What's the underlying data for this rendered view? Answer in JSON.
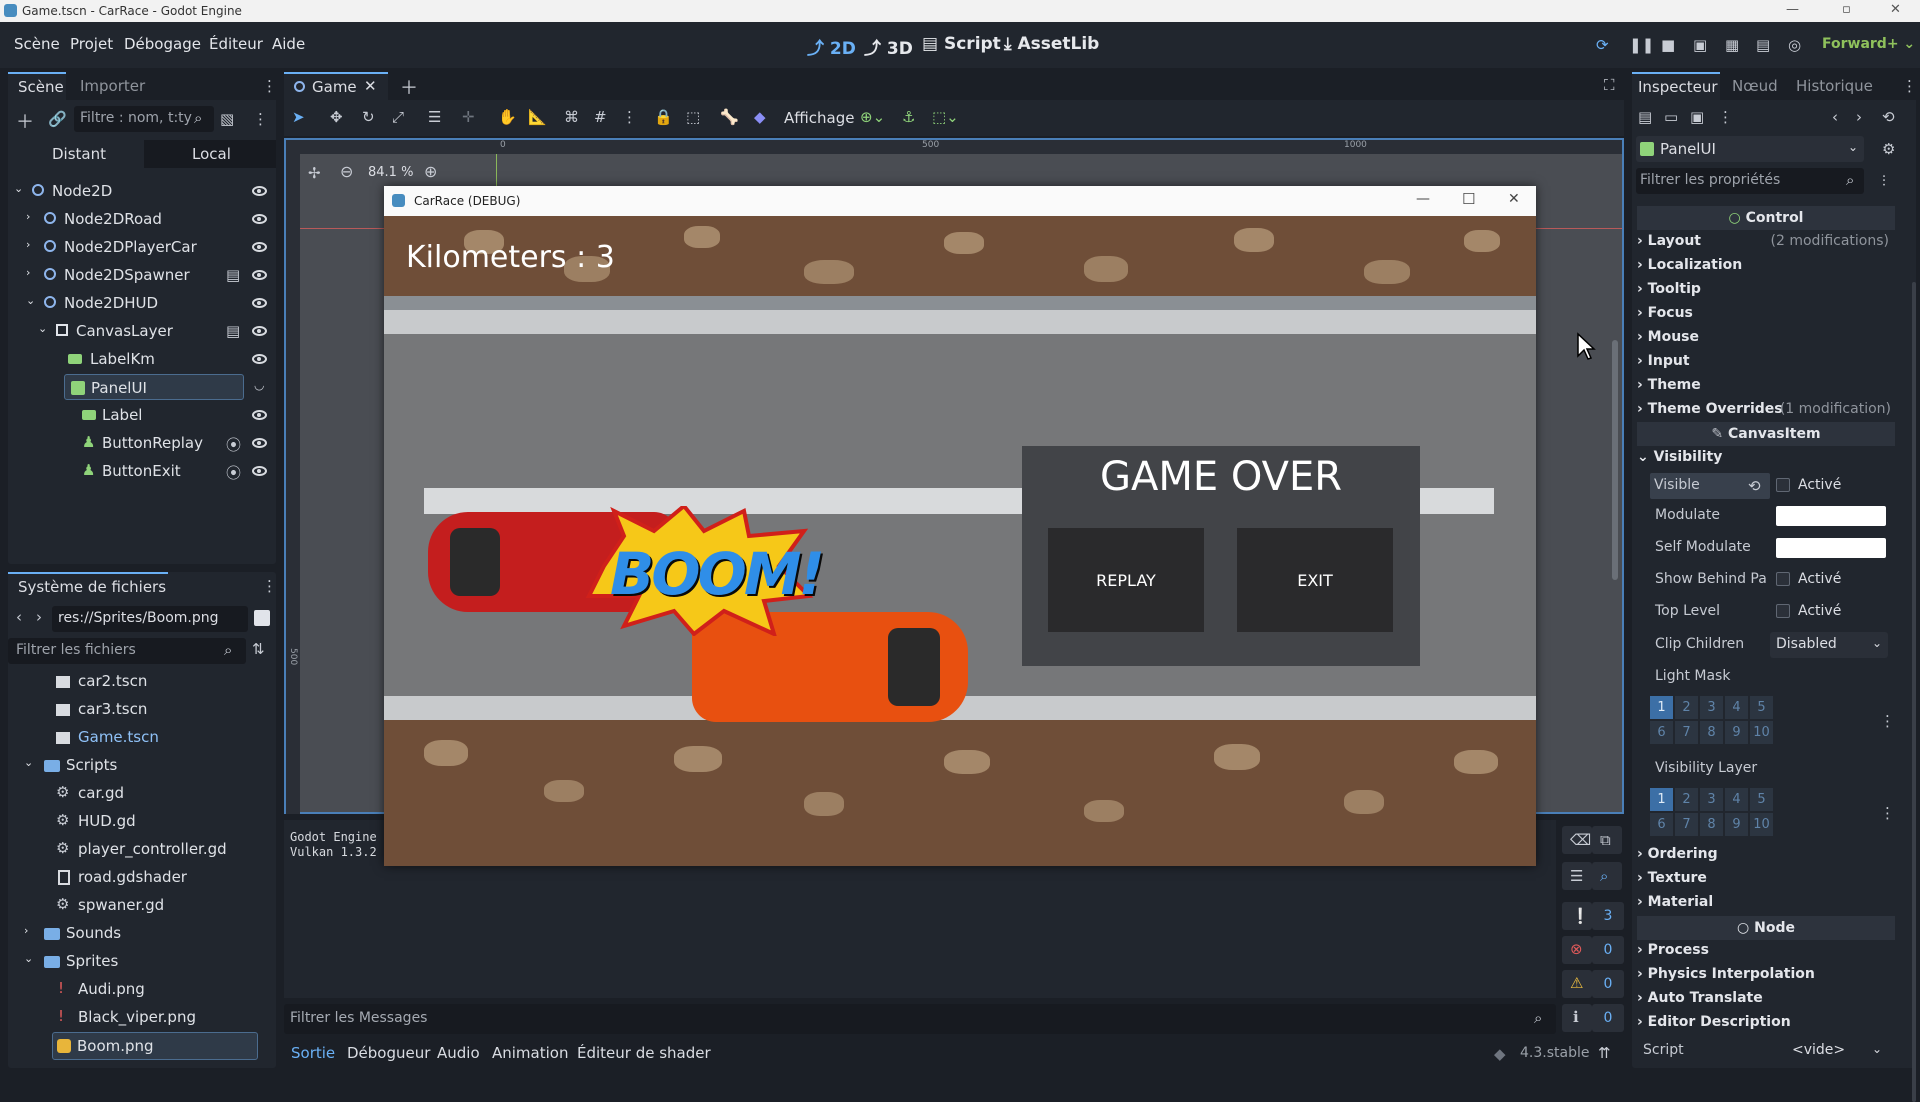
{
  "window": {
    "title": "Game.tscn - CarRace - Godot Engine"
  },
  "menu": [
    "Scène",
    "Projet",
    "Débogage",
    "Éditeur",
    "Aide"
  ],
  "modes": [
    {
      "label": "2D",
      "active": true
    },
    {
      "label": "3D"
    },
    {
      "label": "Script"
    },
    {
      "label": "AssetLib"
    }
  ],
  "renderer": "Forward+",
  "scene_panel": {
    "tabs": [
      "Scène",
      "Importer"
    ],
    "filter_placeholder": "Filtre : nom, t:ty",
    "remote_label": "Distant",
    "local_label": "Local",
    "nodes": [
      {
        "name": "Node2D",
        "depth": 0
      },
      {
        "name": "Node2DRoad",
        "depth": 1
      },
      {
        "name": "Node2DPlayerCar",
        "depth": 1
      },
      {
        "name": "Node2DSpawner",
        "depth": 1
      },
      {
        "name": "Node2DHUD",
        "depth": 1
      },
      {
        "name": "CanvasLayer",
        "depth": 2
      },
      {
        "name": "LabelKm",
        "depth": 3
      },
      {
        "name": "PanelUI",
        "depth": 3,
        "selected": true
      },
      {
        "name": "Label",
        "depth": 4
      },
      {
        "name": "ButtonReplay",
        "depth": 4
      },
      {
        "name": "ButtonExit",
        "depth": 4
      }
    ]
  },
  "filesystem": {
    "title": "Système de fichiers",
    "path": "res://Sprites/Boom.png",
    "filter_placeholder": "Filtrer les fichiers",
    "items": [
      {
        "name": "car2.tscn",
        "depth": 1,
        "type": "scene"
      },
      {
        "name": "car3.tscn",
        "depth": 1,
        "type": "scene"
      },
      {
        "name": "Game.tscn",
        "depth": 1,
        "type": "scene",
        "highlight": true
      },
      {
        "name": "Scripts",
        "depth": 0,
        "type": "folder"
      },
      {
        "name": "car.gd",
        "depth": 1,
        "type": "script"
      },
      {
        "name": "HUD.gd",
        "depth": 1,
        "type": "script"
      },
      {
        "name": "player_controller.gd",
        "depth": 1,
        "type": "script"
      },
      {
        "name": "road.gdshader",
        "depth": 1,
        "type": "shader"
      },
      {
        "name": "spwaner.gd",
        "depth": 1,
        "type": "script"
      },
      {
        "name": "Sounds",
        "depth": 0,
        "type": "folder"
      },
      {
        "name": "Sprites",
        "depth": 0,
        "type": "folder"
      },
      {
        "name": "Audi.png",
        "depth": 1,
        "type": "image"
      },
      {
        "name": "Black_viper.png",
        "depth": 1,
        "type": "image"
      },
      {
        "name": "Boom.png",
        "depth": 1,
        "type": "image",
        "selected": true
      }
    ]
  },
  "editor": {
    "tab": "Game",
    "view_menu": "Affichage",
    "zoom": "84.1 %",
    "ruler_marks": [
      "0",
      "500",
      "1000"
    ],
    "ruler_left_mark": "500"
  },
  "game_window": {
    "title": "CarRace (DEBUG)",
    "km_label": "Kilometers : 3",
    "game_over": "GAME OVER",
    "replay": "REPLAY",
    "exit": "EXIT",
    "boom": "BOOM!"
  },
  "output": {
    "lines": [
      "Godot Engine",
      "Vulkan 1.3.2"
    ],
    "filter_placeholder": "Filtrer les Messages",
    "tabs": [
      "Sortie",
      "Débogueur",
      "Audio",
      "Animation",
      "Éditeur de shader"
    ],
    "version": "4.3.stable",
    "counts": {
      "messages": "3",
      "errors": "0",
      "warnings": "0",
      "info": "0"
    }
  },
  "inspector": {
    "tabs": [
      "Inspecteur",
      "Nœud",
      "Historique"
    ],
    "node_name": "PanelUI",
    "filter_placeholder": "Filtrer les propriétés",
    "cat_control": "Control",
    "control_sections": [
      {
        "name": "Layout",
        "note": "(2 modifications)"
      },
      {
        "name": "Localization"
      },
      {
        "name": "Tooltip"
      },
      {
        "name": "Focus"
      },
      {
        "name": "Mouse"
      },
      {
        "name": "Input"
      },
      {
        "name": "Theme"
      },
      {
        "name": "Theme Overrides",
        "note": "(1 modification)"
      }
    ],
    "cat_canvas": "CanvasItem",
    "visibility": "Visibility",
    "props": {
      "visible": "Visible",
      "active": "Activé",
      "modulate": "Modulate",
      "self_modulate": "Self Modulate",
      "show_behind": "Show Behind Pa",
      "top_level": "Top Level",
      "clip_children": "Clip Children",
      "clip_value": "Disabled",
      "light_mask": "Light Mask",
      "visibility_layer": "Visibility Layer"
    },
    "layer_numbers": [
      "1",
      "2",
      "3",
      "4",
      "5",
      "6",
      "7",
      "8",
      "9",
      "10"
    ],
    "canvas_sections": [
      "Ordering",
      "Texture",
      "Material"
    ],
    "cat_node": "Node",
    "node_sections": [
      "Process",
      "Physics Interpolation",
      "Auto Translate",
      "Editor Description"
    ],
    "script_label": "Script",
    "script_value": "<vide>"
  },
  "colors": {
    "accent": "#6ab0f5",
    "bg": "#1b1f26",
    "panel": "#21262e"
  }
}
